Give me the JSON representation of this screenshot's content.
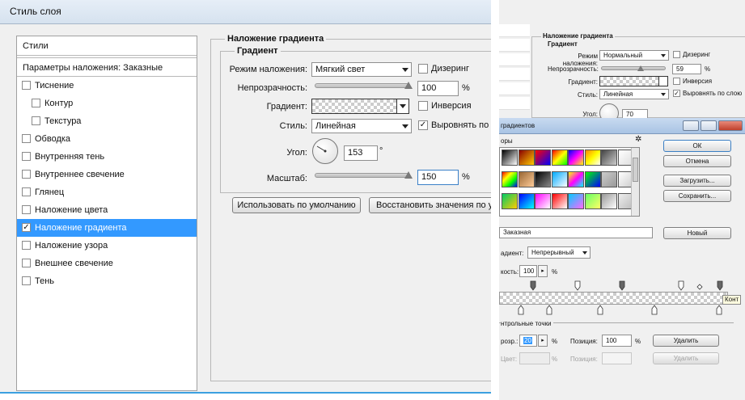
{
  "dialog": {
    "title": "Стиль слоя",
    "styles_header": "Стили",
    "blending_options": "Параметры наложения: Заказные",
    "style_items": [
      {
        "label": "Тиснение",
        "checked": false,
        "indent": false,
        "selected": false
      },
      {
        "label": "Контур",
        "checked": false,
        "indent": true,
        "selected": false
      },
      {
        "label": "Текстура",
        "checked": false,
        "indent": true,
        "selected": false
      },
      {
        "label": "Обводка",
        "checked": false,
        "indent": false,
        "selected": false
      },
      {
        "label": "Внутренняя тень",
        "checked": false,
        "indent": false,
        "selected": false
      },
      {
        "label": "Внутреннее свечение",
        "checked": false,
        "indent": false,
        "selected": false
      },
      {
        "label": "Глянец",
        "checked": false,
        "indent": false,
        "selected": false
      },
      {
        "label": "Наложение цвета",
        "checked": false,
        "indent": false,
        "selected": false
      },
      {
        "label": "Наложение градиента",
        "checked": true,
        "indent": false,
        "selected": true
      },
      {
        "label": "Наложение узора",
        "checked": false,
        "indent": false,
        "selected": false
      },
      {
        "label": "Внешнее свечение",
        "checked": false,
        "indent": false,
        "selected": false
      },
      {
        "label": "Тень",
        "checked": false,
        "indent": false,
        "selected": false
      }
    ],
    "section_title": "Наложение градиента",
    "group_title": "Градиент",
    "blend_mode_label": "Режим наложения:",
    "blend_mode_value": "Мягкий свет",
    "dither_label": "Дизеринг",
    "opacity_label": "Непрозрачность:",
    "opacity_value": "100",
    "opacity_fraction": 1.0,
    "unit_percent": "%",
    "gradient_label": "Градиент:",
    "reverse_label": "Инверсия",
    "style_label": "Стиль:",
    "style_value": "Линейная",
    "align_label": "Выровнять по с",
    "align_checked": true,
    "angle_label": "Угол:",
    "angle_value": "153",
    "unit_degree": "°",
    "scale_label": "Масштаб:",
    "scale_value": "150",
    "scale_fraction": 1.0,
    "default_button": "Использовать по умолчанию",
    "reset_button": "Восстановить значения по ум"
  },
  "background_dialog": {
    "section_title": "Наложение градиента",
    "group_title": "Градиент",
    "blend_mode_label": "Режим наложения:",
    "blend_mode_value": "Нормальный",
    "dither_label": "Дизеринг",
    "opacity_label": "Непрозрачность:",
    "opacity_value": "59",
    "unit_percent": "%",
    "gradient_label": "Градиент:",
    "reverse_label": "Инверсия",
    "style_label": "Стиль:",
    "style_value": "Линейная",
    "align_label": "Выровнять по слою",
    "angle_label": "Угол:",
    "angle_value": "70"
  },
  "gradient_editor": {
    "title": "градиентов",
    "presets_label": "оры",
    "ok_button": "ОК",
    "cancel_button": "Отмена",
    "load_button": "Загрузить...",
    "save_button": "Сохранить...",
    "name_value": "Заказная",
    "new_button": "Новый",
    "type_label": "адиент:",
    "type_value": "Непрерывный",
    "smoothness_label": "кость:",
    "smoothness_value": "100",
    "unit_percent": "%",
    "tooltip_text": "Конт",
    "stops_section": "нтрольные точки",
    "opacity_label": "розр.:",
    "opacity_value": "20",
    "position_label": "Позиция:",
    "position_value": "100",
    "delete_button": "Удалить",
    "color_label": "Цвет:",
    "color_position_label": "Позиция:",
    "color_delete_button": "Удалить"
  },
  "colors": {
    "selection": "#3399ff",
    "accent_line": "#3ba0e0"
  }
}
